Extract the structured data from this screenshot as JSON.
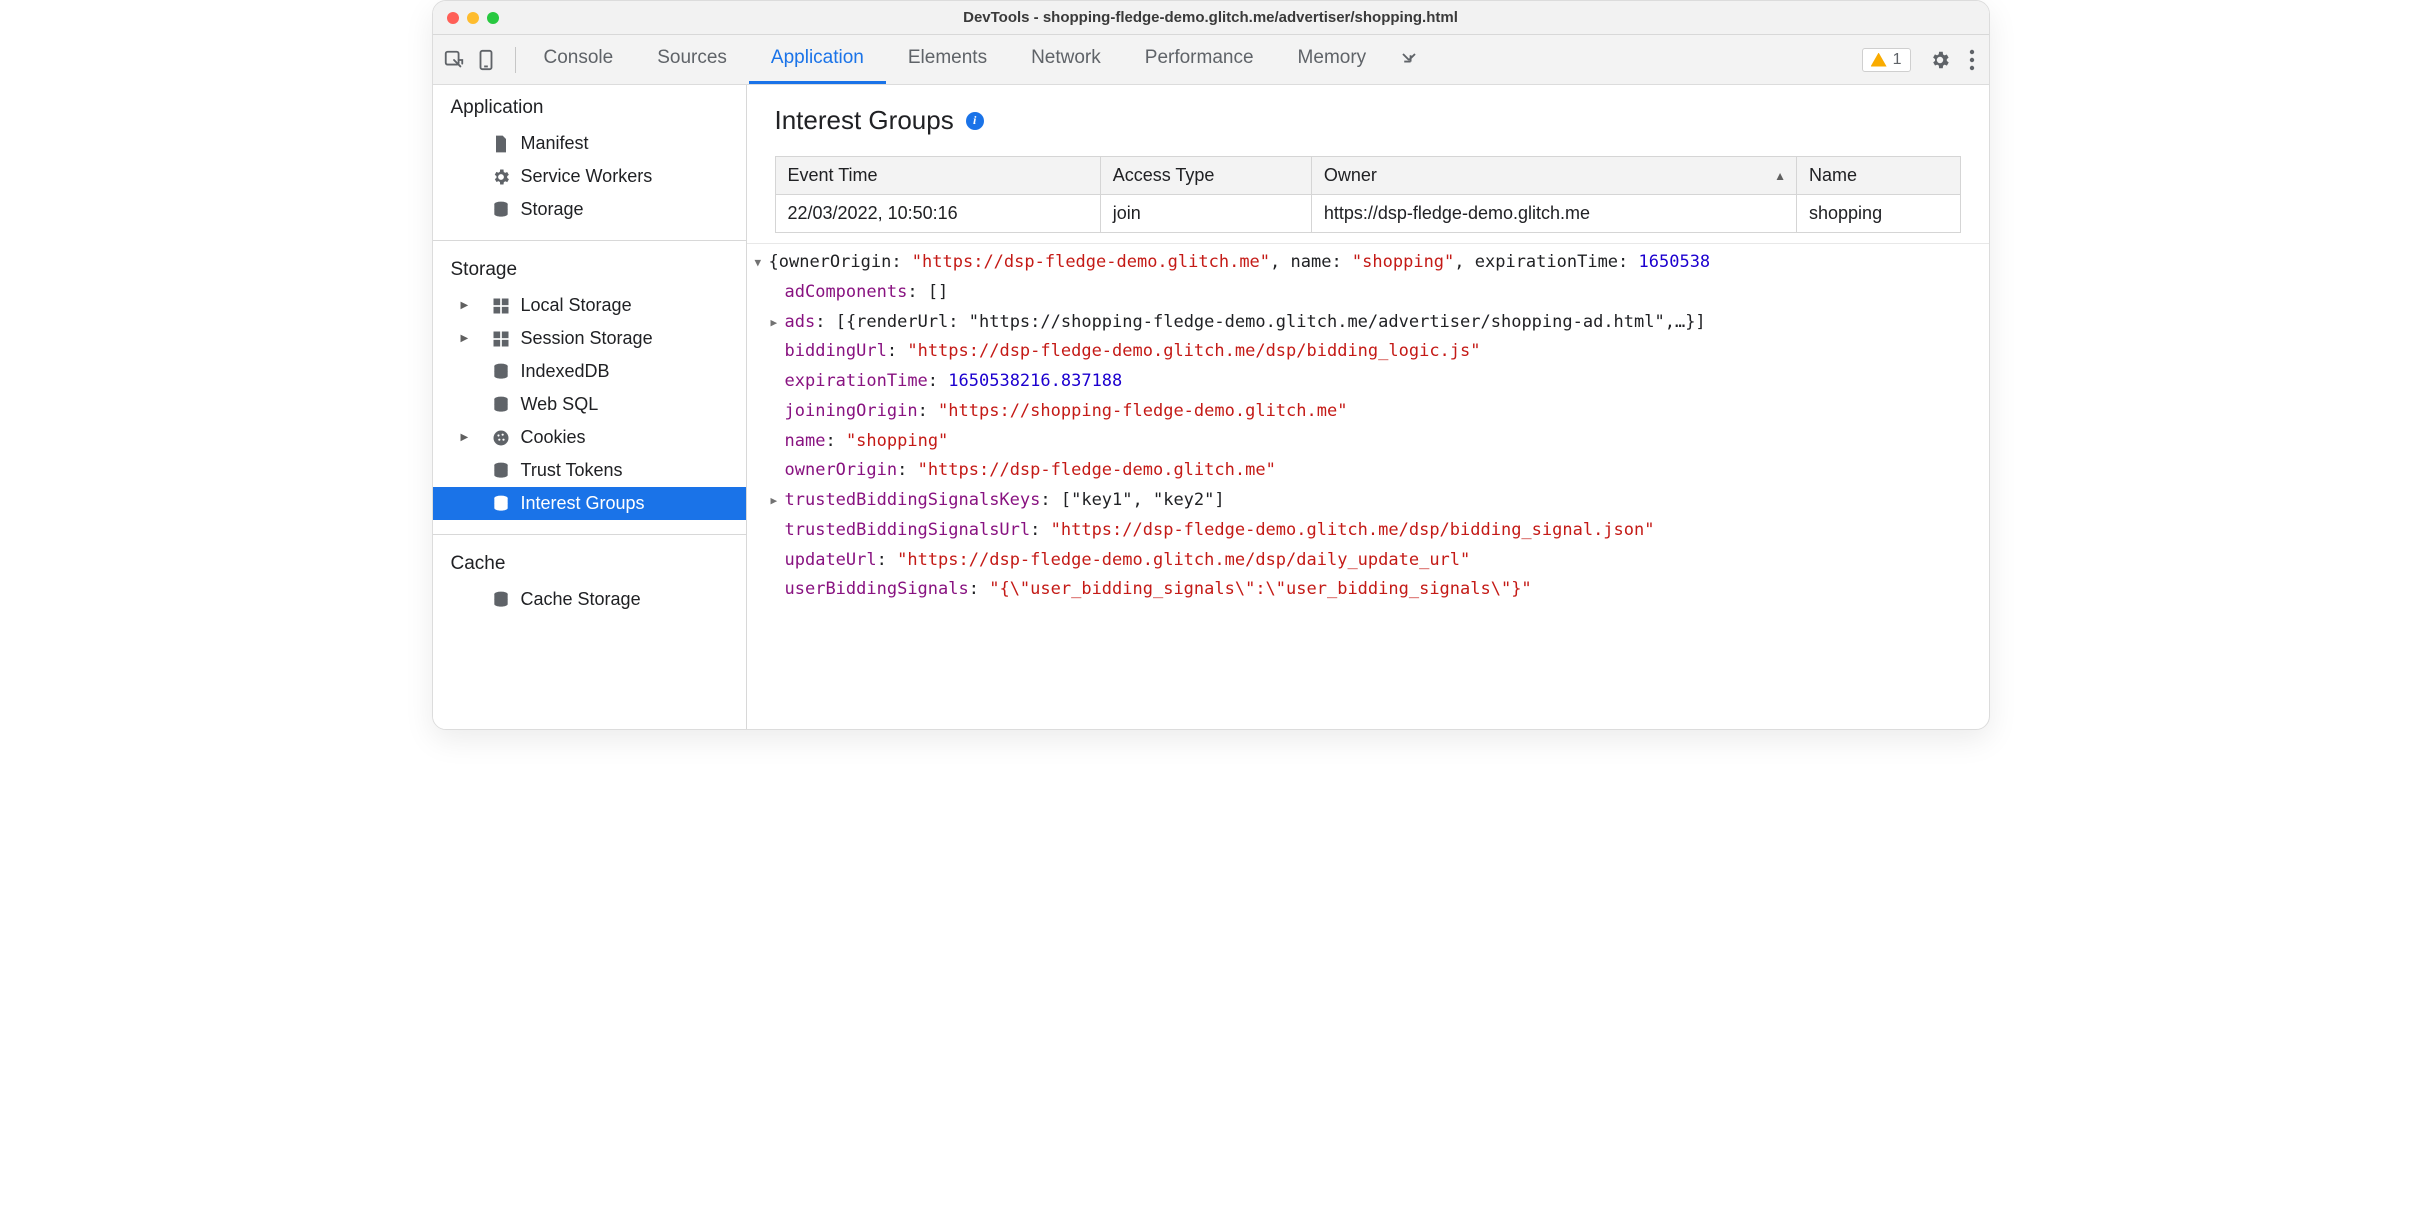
{
  "window": {
    "title": "DevTools - shopping-fledge-demo.glitch.me/advertiser/shopping.html"
  },
  "toolbar": {
    "tabs": [
      "Console",
      "Sources",
      "Application",
      "Elements",
      "Network",
      "Performance",
      "Memory"
    ],
    "active_tab_index": 2,
    "warning_count": "1"
  },
  "sidebar": {
    "sections": [
      {
        "heading": "Application",
        "items": [
          {
            "label": "Manifest",
            "icon": "file"
          },
          {
            "label": "Service Workers",
            "icon": "gear"
          },
          {
            "label": "Storage",
            "icon": "db"
          }
        ]
      },
      {
        "heading": "Storage",
        "items": [
          {
            "label": "Local Storage",
            "icon": "grid",
            "caret": true
          },
          {
            "label": "Session Storage",
            "icon": "grid",
            "caret": true
          },
          {
            "label": "IndexedDB",
            "icon": "db"
          },
          {
            "label": "Web SQL",
            "icon": "db"
          },
          {
            "label": "Cookies",
            "icon": "cookie",
            "caret": true
          },
          {
            "label": "Trust Tokens",
            "icon": "db"
          },
          {
            "label": "Interest Groups",
            "icon": "db",
            "selected": true
          }
        ]
      },
      {
        "heading": "Cache",
        "items": [
          {
            "label": "Cache Storage",
            "icon": "db"
          }
        ]
      }
    ]
  },
  "panel": {
    "title": "Interest Groups",
    "table": {
      "headers": [
        "Event Time",
        "Access Type",
        "Owner",
        "Name"
      ],
      "sorted_col_index": 2,
      "rows": [
        [
          "22/03/2022, 10:50:16",
          "join",
          "https://dsp-fledge-demo.glitch.me",
          "shopping"
        ]
      ]
    },
    "tree": {
      "firstline_prefix": "{ownerOrigin: ",
      "firstline_owner": "\"https://dsp-fledge-demo.glitch.me\"",
      "firstline_mid1": ", name: ",
      "firstline_name": "\"shopping\"",
      "firstline_mid2": ", expirationTime: ",
      "firstline_expnum": "1650538",
      "rows": [
        {
          "k": "adComponents",
          "v": "[]",
          "type": "punct"
        },
        {
          "k": "ads",
          "caret": true,
          "v": "[{renderUrl: \"https://shopping-fledge-demo.glitch.me/advertiser/shopping-ad.html\",…}]",
          "type": "punct"
        },
        {
          "k": "biddingUrl",
          "v": "\"https://dsp-fledge-demo.glitch.me/dsp/bidding_logic.js\"",
          "type": "str"
        },
        {
          "k": "expirationTime",
          "v": "1650538216.837188",
          "type": "num"
        },
        {
          "k": "joiningOrigin",
          "v": "\"https://shopping-fledge-demo.glitch.me\"",
          "type": "str"
        },
        {
          "k": "name",
          "v": "\"shopping\"",
          "type": "str"
        },
        {
          "k": "ownerOrigin",
          "v": "\"https://dsp-fledge-demo.glitch.me\"",
          "type": "str"
        },
        {
          "k": "trustedBiddingSignalsKeys",
          "caret": true,
          "v": "[\"key1\", \"key2\"]",
          "type": "punct"
        },
        {
          "k": "trustedBiddingSignalsUrl",
          "v": "\"https://dsp-fledge-demo.glitch.me/dsp/bidding_signal.json\"",
          "type": "str"
        },
        {
          "k": "updateUrl",
          "v": "\"https://dsp-fledge-demo.glitch.me/dsp/daily_update_url\"",
          "type": "str"
        },
        {
          "k": "userBiddingSignals",
          "v": "\"{\\\"user_bidding_signals\\\":\\\"user_bidding_signals\\\"}\"",
          "type": "str"
        }
      ]
    }
  }
}
